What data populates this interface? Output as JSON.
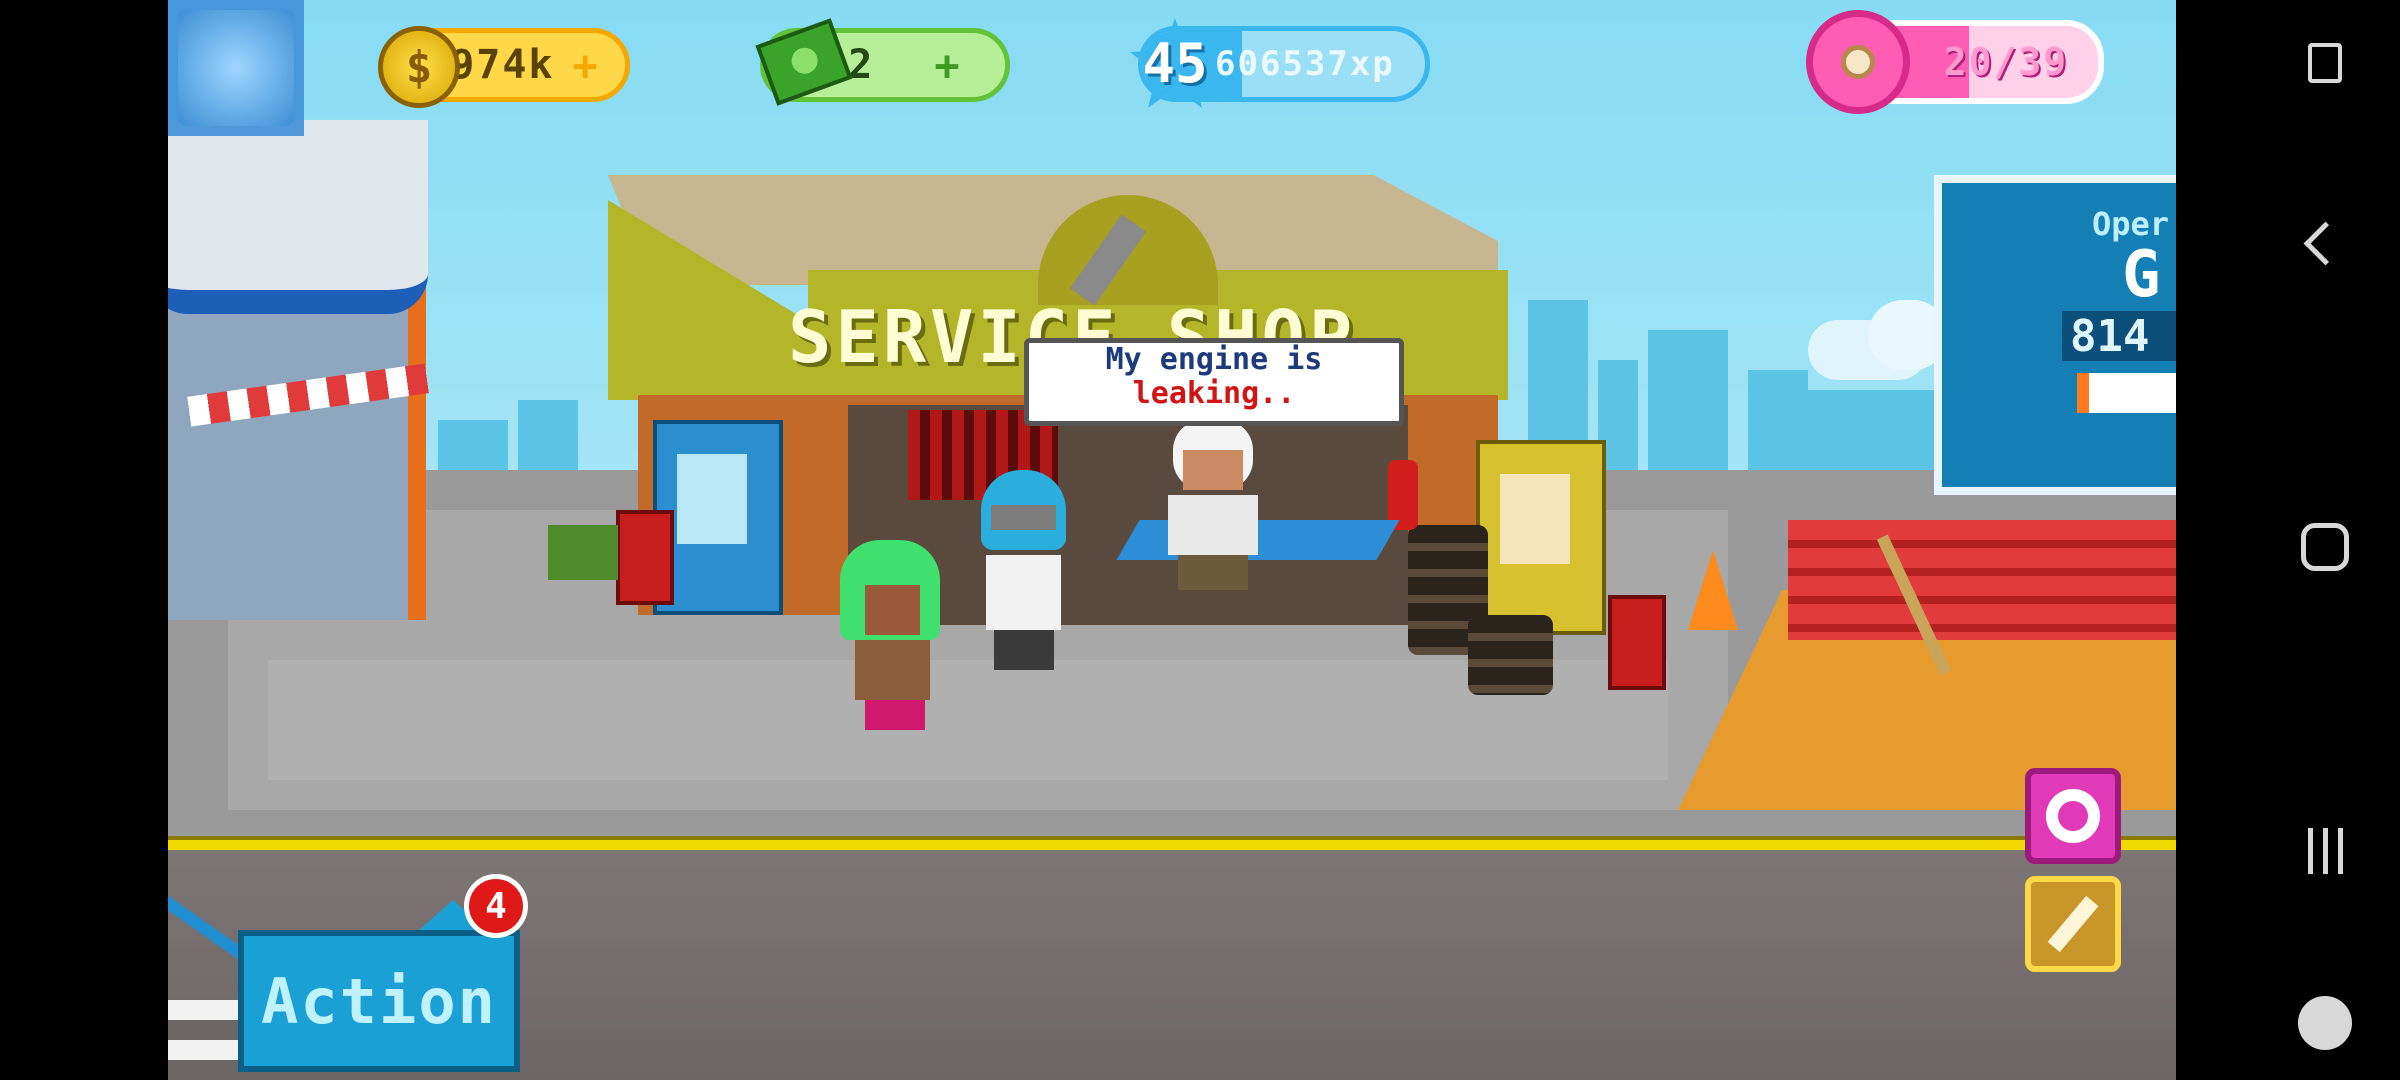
{
  "hud": {
    "coins": {
      "value": "974k",
      "icon": "dollar-coin-icon",
      "plus": "+"
    },
    "cash": {
      "value": "2",
      "icon": "cash-bill-icon",
      "plus": "+"
    },
    "level": {
      "number": "45",
      "xp": "606537xp",
      "progress_fraction": 0.35
    },
    "donuts": {
      "value": "20/39",
      "progress_fraction": 0.51
    }
  },
  "scene": {
    "sign": {
      "line1": "SERVICE SHOP"
    },
    "speech": {
      "line1": "My engine is",
      "line2": "leaking.."
    },
    "billboard": {
      "title": "Oper",
      "big": "G",
      "value": "814"
    }
  },
  "controls": {
    "action_label": "Action",
    "action_badge": "4",
    "donut_button": "donut-icon",
    "wrench_button": "wrench-icon"
  },
  "colors": {
    "gold": "#ffd84a",
    "green": "#7edc5e",
    "xp_blue": "#39b7ee",
    "pink": "#ff5cb4",
    "action_blue": "#1aa0d4",
    "curb_yellow": "#f1d800"
  }
}
